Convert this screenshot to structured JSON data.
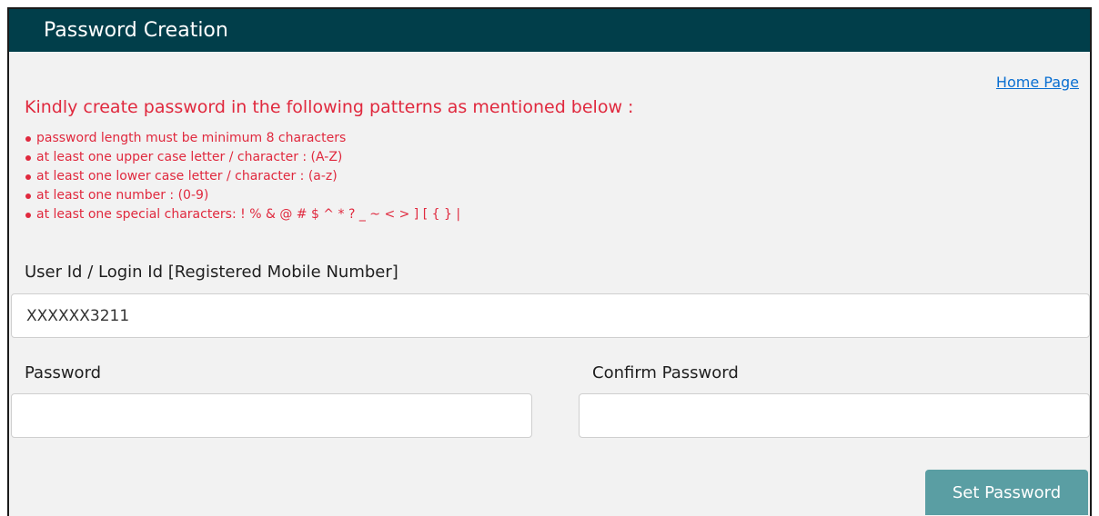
{
  "header": {
    "title": "Password Creation"
  },
  "nav": {
    "home_link": "Home Page"
  },
  "instructions": {
    "heading": "Kindly create password in the following patterns as mentioned below :",
    "rules": [
      "password length must be minimum 8 characters",
      "at least one upper case letter / character : (A-Z)",
      "at least one lower case letter / character : (a-z)",
      "at least one number : (0-9)",
      "at least one special characters: ! % & @ # $ ^ * ? _ ~ < > ] [ { } |"
    ]
  },
  "form": {
    "user_id_label": "User Id / Login Id [Registered Mobile Number]",
    "user_id_value": "XXXXXX3211",
    "password_label": "Password",
    "password_value": "",
    "confirm_label": "Confirm Password",
    "confirm_value": "",
    "submit_label": "Set Password"
  },
  "colors": {
    "header_bg": "#013e4a",
    "instruction_text": "#e0293e",
    "link": "#0a6fd1",
    "button_bg": "#5a9ea3",
    "panel_bg": "#f2f2f2"
  }
}
